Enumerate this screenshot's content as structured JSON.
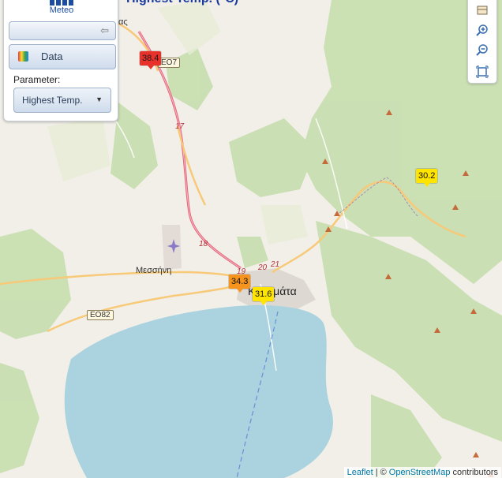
{
  "panel": {
    "brand": "Meteo",
    "data_button": "Data",
    "parameter_label": "Parameter:",
    "parameter_value": "Highest Temp."
  },
  "map": {
    "title": "Highest Temp. (°C)",
    "labels": {
      "village_top": "ας",
      "messini": "Μεσσήνη",
      "kalamata": "Καλαμάτα",
      "road_17": "17",
      "road_18": "18",
      "road_19": "19",
      "road_20": "20",
      "road_21": "21",
      "eo7": "ΕΟ7",
      "eo82": "ΕΟ82"
    },
    "markers": [
      {
        "value": "38.4",
        "level": "hot",
        "color": "#e8312a"
      },
      {
        "value": "30.2",
        "level": "yellow",
        "color": "#ffe400"
      },
      {
        "value": "34.3",
        "level": "orange",
        "color": "#f7941d"
      },
      {
        "value": "31.6",
        "level": "yellow",
        "color": "#ffe400"
      }
    ]
  },
  "tools": [
    {
      "icon": "layers-icon"
    },
    {
      "icon": "zoom-in-icon"
    },
    {
      "icon": "zoom-out-icon"
    },
    {
      "icon": "fullscreen-icon"
    }
  ],
  "attribution": {
    "leaflet": "Leaflet",
    "separator": "| ©",
    "osm": "OpenStreetMap",
    "contributors": "contributors"
  },
  "colors": {
    "sea": "#aad3df",
    "forest": "#c8dfb1",
    "land": "#f2efe9",
    "motorway": "#e4657a",
    "primary": "#f7c978"
  }
}
